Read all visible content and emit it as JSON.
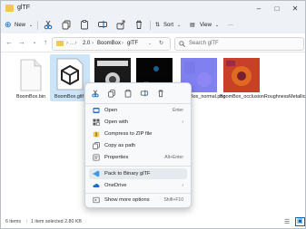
{
  "window": {
    "title": "glTF"
  },
  "toolbar": {
    "new_label": "New",
    "sort_label": "Sort",
    "view_label": "View",
    "more_label": "···"
  },
  "address": {
    "crumbs": [
      "2.0",
      "BoomBox",
      "glTF"
    ],
    "search_placeholder": "Search glTF"
  },
  "files": [
    {
      "name": "BoomBox.bin"
    },
    {
      "name": "BoomBox.gltf"
    },
    {
      "name": ""
    },
    {
      "name": ""
    },
    {
      "name": "BoomBox_normal.png"
    },
    {
      "name": "BoomBox_occlusionRoughnessMetallic.png"
    }
  ],
  "context_menu": {
    "items": [
      {
        "label": "Open",
        "shortcut": "Enter"
      },
      {
        "label": "Open with",
        "shortcut": ""
      },
      {
        "label": "Compress to ZIP file",
        "shortcut": ""
      },
      {
        "label": "Copy as path",
        "shortcut": ""
      },
      {
        "label": "Properties",
        "shortcut": "Alt+Enter"
      },
      {
        "label": "Pack to Binary glTF",
        "shortcut": ""
      },
      {
        "label": "OneDrive",
        "shortcut": ""
      },
      {
        "label": "Show more options",
        "shortcut": "Shift+F10"
      }
    ]
  },
  "status": {
    "items_count": "6 items",
    "selection": "1 item selected  2.80 KB"
  },
  "colors": {
    "accent": "#0067c0",
    "folder": "#f2c94c"
  }
}
